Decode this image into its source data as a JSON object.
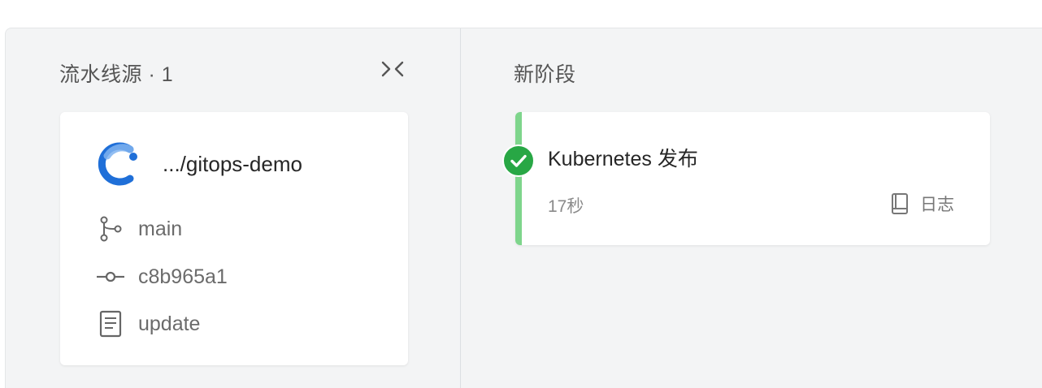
{
  "source_column": {
    "title": "流水线源 · 1",
    "collapse_icon": "collapse-icon",
    "source": {
      "repo_icon": "repo-logo-icon",
      "repo_name": ".../gitops-demo",
      "branch_icon": "branch-icon",
      "branch": "main",
      "commit_icon": "commit-icon",
      "commit": "c8b965a1",
      "message_icon": "document-icon",
      "message": "update"
    }
  },
  "stage_column": {
    "title": "新阶段",
    "job": {
      "status": "success",
      "status_icon": "check-circle-icon",
      "name": "Kubernetes 发布",
      "duration": "17秒",
      "log_icon": "book-icon",
      "log_label": "日志"
    }
  },
  "colors": {
    "success": "#28a745",
    "accent_bar": "#7ed58c",
    "board_bg": "#f3f4f5",
    "logo_blue": "#1f6fd8"
  }
}
